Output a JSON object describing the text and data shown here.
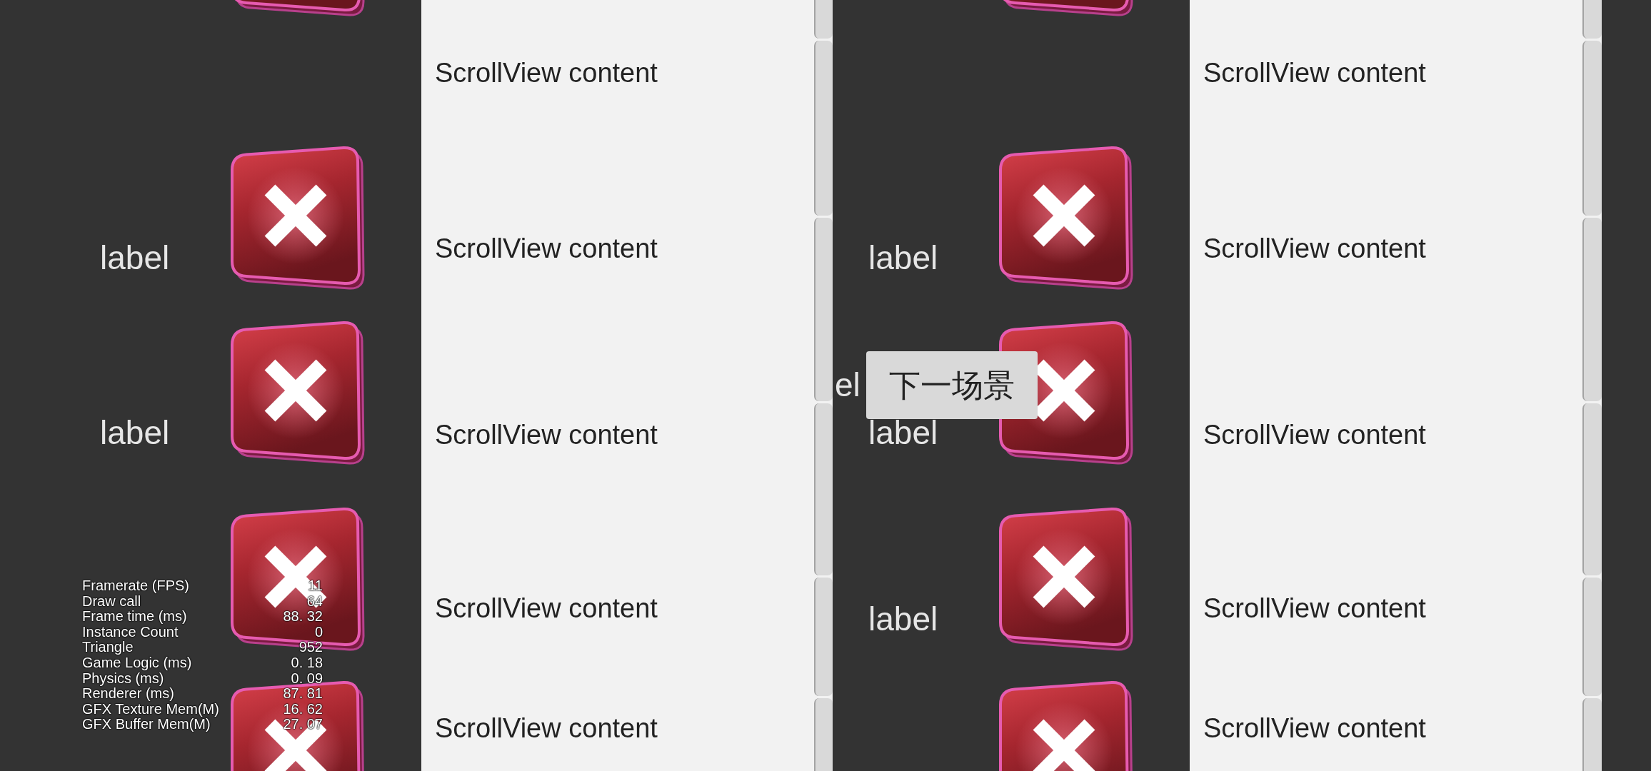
{
  "panels": [
    {
      "rows": [
        {
          "kind": "button"
        },
        {
          "kind": "labeled_button",
          "label": "label"
        },
        {
          "kind": "labeled_button",
          "label": "label"
        },
        {
          "kind": "button"
        },
        {
          "kind": "button"
        }
      ],
      "scroll_items": [
        "ScrollView content",
        "ScrollView content",
        "ScrollView content",
        "ScrollView content",
        "ScrollView content"
      ]
    },
    {
      "rows": [
        {
          "kind": "button"
        },
        {
          "kind": "labeled_button",
          "label": "label"
        },
        {
          "kind": "labeled_button",
          "label": "label"
        },
        {
          "kind": "labeled_button",
          "label": "label"
        },
        {
          "kind": "button"
        }
      ],
      "scroll_items": [
        "ScrollView content",
        "ScrollView content",
        "ScrollView content",
        "ScrollView content",
        "ScrollView content"
      ],
      "overlay": {
        "label": "el",
        "button": "下一场景"
      }
    }
  ],
  "stats": [
    {
      "name": "Framerate (FPS)",
      "value": "11"
    },
    {
      "name": "Draw call",
      "value": "64"
    },
    {
      "name": "Frame time (ms)",
      "value": "88. 32"
    },
    {
      "name": "Instance Count",
      "value": "0"
    },
    {
      "name": "Triangle",
      "value": "952"
    },
    {
      "name": "Game Logic (ms)",
      "value": "0. 18"
    },
    {
      "name": "Physics (ms)",
      "value": "0. 09"
    },
    {
      "name": "Renderer (ms)",
      "value": "87. 81"
    },
    {
      "name": "GFX Texture Mem(M)",
      "value": "16. 62"
    },
    {
      "name": "GFX Buffer Mem(M)",
      "value": "27. 07"
    }
  ]
}
